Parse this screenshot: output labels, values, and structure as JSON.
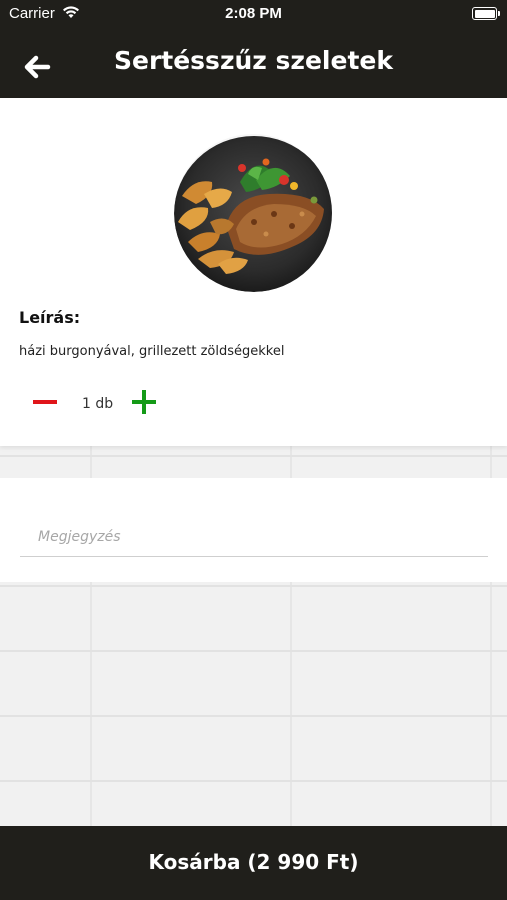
{
  "status_bar": {
    "carrier": "Carrier",
    "time": "2:08 PM"
  },
  "header": {
    "title": "Sertésszűz szeletek"
  },
  "product": {
    "description_label": "Leírás:",
    "description": "házi burgonyával, grillezett zöldségekkel",
    "quantity": "1 db"
  },
  "note": {
    "placeholder": "Megjegyzés",
    "value": ""
  },
  "cart": {
    "button_label": "Kosárba (2 990 Ft)"
  },
  "colors": {
    "bar": "#201f1b",
    "minus": "#e0151a",
    "plus": "#149a17",
    "card": "#ffffff"
  },
  "icons": {
    "back": "back-arrow-icon",
    "wifi": "wifi-icon",
    "battery": "battery-icon",
    "minus": "minus-icon",
    "plus": "plus-icon"
  }
}
